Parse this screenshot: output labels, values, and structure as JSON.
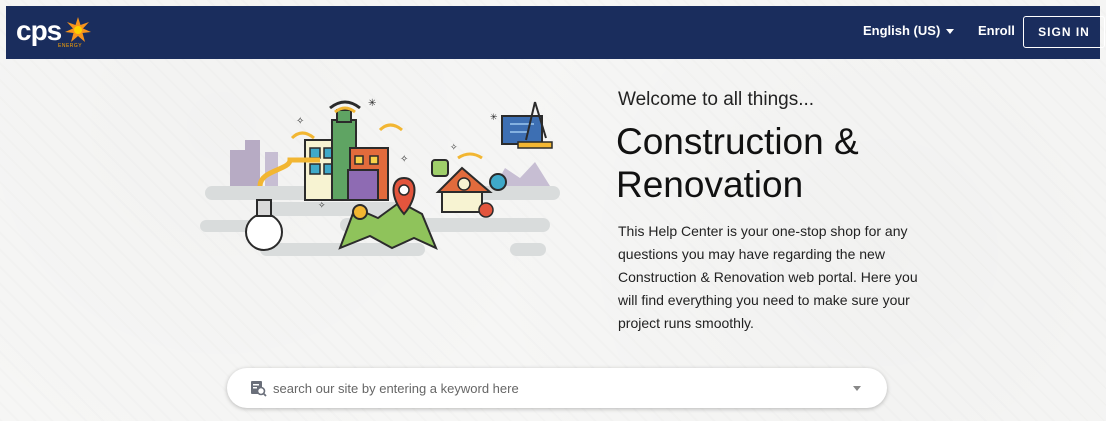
{
  "header": {
    "logo": {
      "text": "cps",
      "subtext": "ENERGY",
      "accent_color": "#ffa500"
    },
    "language_label": "English (US)",
    "enroll_label": "Enroll",
    "signin_label": "SIGN IN",
    "background_color": "#1a2d5d"
  },
  "hero": {
    "welcome": "Welcome to all things...",
    "title_line1": "Construction &",
    "title_line2": "Renovation",
    "description": "This Help Center is your one-stop shop for any questions you may have regarding the new Construction & Renovation web portal. Here you will find everything you need to make sure your project runs smoothly."
  },
  "search": {
    "placeholder": "search our site by entering a keyword here",
    "value": ""
  },
  "icons": {
    "search": "search-document-icon",
    "language_dropdown": "chevron-down-icon",
    "search_dropdown": "chevron-down-icon",
    "logo_mark": "starburst-icon"
  }
}
